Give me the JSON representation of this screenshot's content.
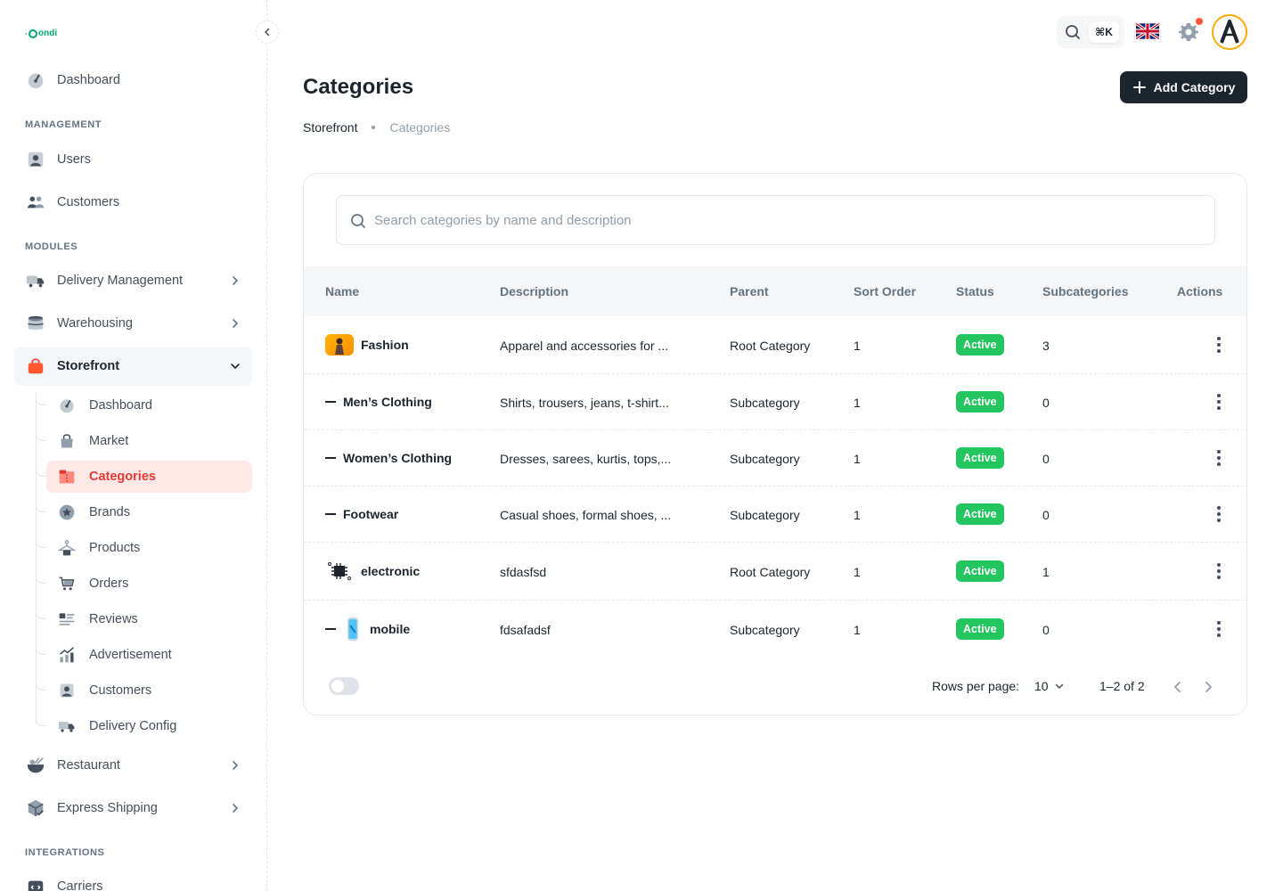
{
  "brand": {
    "logo_text": "ondi",
    "accent": "#00a76f"
  },
  "sidebar": {
    "top_item": {
      "label": "Dashboard",
      "icon": "dashboard-icon"
    },
    "sections": [
      {
        "label": "MANAGEMENT"
      },
      {
        "label": "MODULES"
      },
      {
        "label": "INTEGRATIONS"
      }
    ],
    "management": [
      {
        "label": "Users",
        "icon": "user-icon"
      },
      {
        "label": "Customers",
        "icon": "customers-icon"
      }
    ],
    "modules": [
      {
        "label": "Delivery Management",
        "icon": "truck-icon"
      },
      {
        "label": "Warehousing",
        "icon": "warehouse-icon"
      },
      {
        "label": "Storefront",
        "icon": "shopping-bag-icon",
        "expanded": true
      },
      {
        "label": "Restaurant",
        "icon": "bowl-icon"
      },
      {
        "label": "Express Shipping",
        "icon": "package-icon"
      }
    ],
    "storefront_sub": [
      {
        "label": "Dashboard",
        "icon": "dashboard-icon"
      },
      {
        "label": "Market",
        "icon": "bag-icon"
      },
      {
        "label": "Categories",
        "icon": "categories-icon",
        "active": true
      },
      {
        "label": "Brands",
        "icon": "star-badge-icon"
      },
      {
        "label": "Products",
        "icon": "hanger-icon"
      },
      {
        "label": "Orders",
        "icon": "cart-icon"
      },
      {
        "label": "Reviews",
        "icon": "reviews-icon"
      },
      {
        "label": "Advertisement",
        "icon": "chart-up-icon"
      },
      {
        "label": "Customers",
        "icon": "user-icon"
      },
      {
        "label": "Delivery Config",
        "icon": "truck-icon"
      }
    ],
    "integrations": [
      {
        "label": "Carriers",
        "icon": "carriers-icon"
      }
    ]
  },
  "header": {
    "shortcut": "⌘K",
    "notification_color": "#ff5630"
  },
  "page": {
    "title": "Categories",
    "add_button_label": "Add Category",
    "breadcrumb": [
      "Storefront",
      "Categories"
    ]
  },
  "search": {
    "placeholder": "Search categories by name and description",
    "value": ""
  },
  "table": {
    "columns": [
      "Name",
      "Description",
      "Parent",
      "Sort Order",
      "Status",
      "Subcategories",
      "Actions"
    ],
    "rows": [
      {
        "name": "Fashion",
        "description": "Apparel and accessories for ...",
        "parent": "Root Category",
        "sort_order": "1",
        "status": "Active",
        "subcategories": "3",
        "type": "root"
      },
      {
        "name": "Men’s Clothing",
        "description": "Shirts, trousers, jeans, t-shirt...",
        "parent": "Subcategory",
        "sort_order": "1",
        "status": "Active",
        "subcategories": "0",
        "type": "sub"
      },
      {
        "name": "Women’s Clothing",
        "description": "Dresses, sarees, kurtis, tops,...",
        "parent": "Subcategory",
        "sort_order": "1",
        "status": "Active",
        "subcategories": "0",
        "type": "sub"
      },
      {
        "name": "Footwear",
        "description": "Casual shoes, formal shoes, ...",
        "parent": "Subcategory",
        "sort_order": "1",
        "status": "Active",
        "subcategories": "0",
        "type": "sub"
      },
      {
        "name": "electronic",
        "description": "sfdasfsd",
        "parent": "Root Category",
        "sort_order": "1",
        "status": "Active",
        "subcategories": "1",
        "type": "root"
      },
      {
        "name": "mobile",
        "description": "fdsafadsf",
        "parent": "Subcategory",
        "sort_order": "1",
        "status": "Active",
        "subcategories": "0",
        "type": "sub-thumb"
      }
    ],
    "status_color": "#22c55e"
  },
  "pagination": {
    "rows_per_page_label": "Rows per page:",
    "rows_per_page": "10",
    "range": "1–2 of 2"
  }
}
